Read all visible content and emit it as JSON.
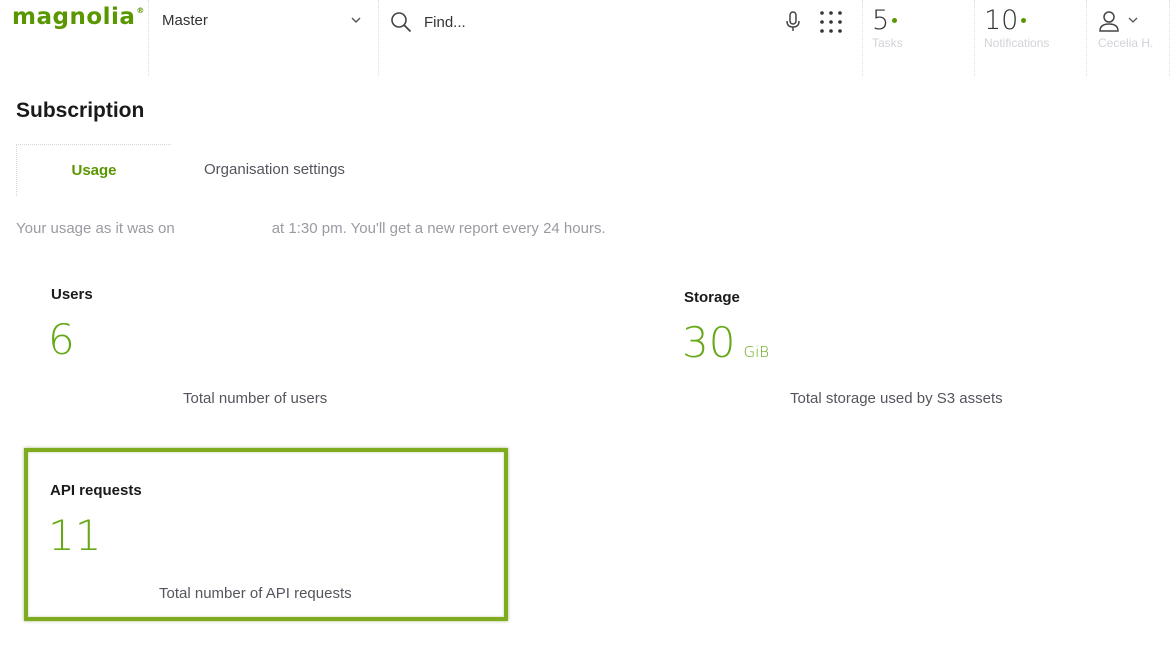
{
  "header": {
    "logo_text": "magnolia",
    "logo_mark": "®",
    "environment": "Master",
    "search": {
      "placeholder": "Find...",
      "value": ""
    },
    "tasks": {
      "count": "5",
      "label": "Tasks"
    },
    "notifications": {
      "count": "10",
      "label": "Notifications"
    },
    "user": {
      "name": "Cecelia H."
    },
    "icons": [
      "chevron-down-icon",
      "search-icon",
      "microphone-icon",
      "apps-grid-icon",
      "user-icon"
    ]
  },
  "page": {
    "title": "Subscription",
    "tabs": [
      {
        "label": "Usage",
        "active": true
      },
      {
        "label": "Organisation settings",
        "active": false
      }
    ],
    "usage_note": {
      "before": "Your usage as it was on",
      "after": "at 1:30 pm. You'll get a new report every 24 hours."
    }
  },
  "metrics": {
    "users": {
      "title": "Users",
      "value": "6",
      "unit": "",
      "description": "Total number of users"
    },
    "storage": {
      "title": "Storage",
      "value": "30",
      "unit": "GiB",
      "description": "Total storage used by S3 assets"
    },
    "api_requests": {
      "title": "API requests",
      "value": "11",
      "unit": "",
      "description": "Total number of API requests",
      "highlighted": true
    }
  },
  "colors": {
    "brand_green": "#599700",
    "value_green": "#66a818",
    "highlight_border": "#7fac1e",
    "muted_text": "#9a9aa3"
  }
}
